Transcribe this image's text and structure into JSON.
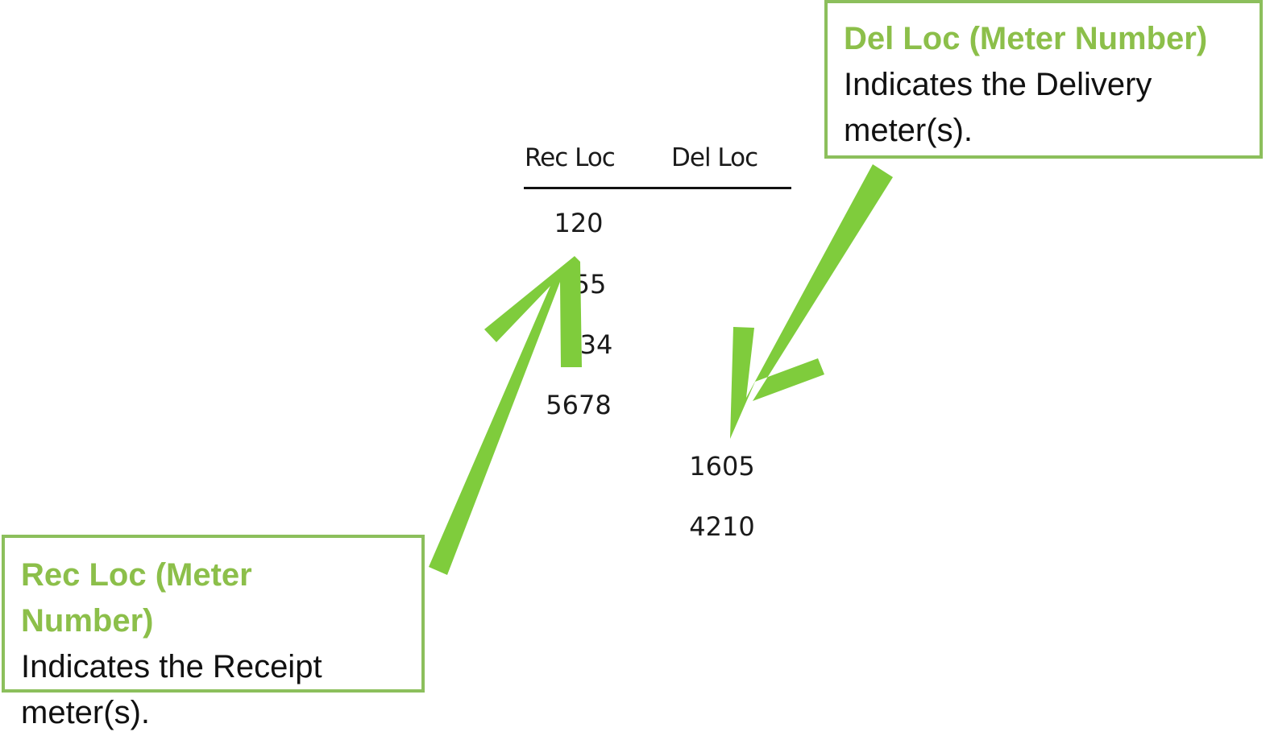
{
  "table": {
    "headers": {
      "rec": "Rec Loc",
      "del": "Del Loc"
    },
    "rec_values": [
      "120",
      "55",
      "34",
      "5678"
    ],
    "del_values": [
      "1605",
      "4210"
    ]
  },
  "callouts": {
    "del": {
      "title": "Del Loc (Meter Number)",
      "body": "Indicates the Delivery meter(s)."
    },
    "rec": {
      "title": "Rec Loc (Meter Number)",
      "body": "Indicates the Receipt meter(s)."
    }
  },
  "colors": {
    "accent_green": "#8cbf4a",
    "arrow_green": "#7fcc3c",
    "text": "#111111"
  }
}
